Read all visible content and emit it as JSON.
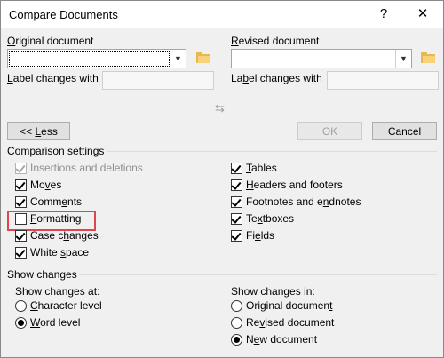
{
  "titlebar": {
    "title": "Compare Documents",
    "help": "?",
    "close": "✕"
  },
  "original": {
    "label_first": "O",
    "label_rest": "riginal document",
    "label_changes_a": "L",
    "label_changes_b": "abel changes with"
  },
  "revised": {
    "label_first": "R",
    "label_rest": "evised document",
    "label_changes_a": "La",
    "label_changes_u": "b",
    "label_changes_b": "el changes with"
  },
  "buttons": {
    "less_a": "<< ",
    "less_u": "L",
    "less_b": "ess",
    "ok": "OK",
    "cancel": "Cancel"
  },
  "comparison_settings": {
    "heading": "Comparison settings",
    "insertions": "Insertions and deletions",
    "moves_a": "Mo",
    "moves_u": "v",
    "moves_b": "es",
    "comments_a": "Comm",
    "comments_u": "e",
    "comments_b": "nts",
    "formatting_u": "F",
    "formatting_b": "ormatting",
    "case_a": "Case c",
    "case_u": "h",
    "case_b": "anges",
    "white_a": "White ",
    "white_u": "s",
    "white_b": "pace",
    "tables_u": "T",
    "tables_b": "ables",
    "headers_u": "H",
    "headers_b": "eaders and footers",
    "footnotes_a": "Footnotes and e",
    "footnotes_u": "n",
    "footnotes_b": "dnotes",
    "textboxes_a": "Te",
    "textboxes_u": "x",
    "textboxes_b": "tboxes",
    "fields_a": "Fi",
    "fields_u": "e",
    "fields_b": "lds"
  },
  "show_changes": {
    "heading": "Show changes",
    "at_label": "Show changes at:",
    "char_u": "C",
    "char_b": "haracter level",
    "word_u": "W",
    "word_b": "ord level",
    "in_label": "Show changes in:",
    "orig_a": "Original documen",
    "orig_u": "t",
    "rev_a": "Re",
    "rev_u": "v",
    "rev_b": "ised document",
    "new_a": "N",
    "new_u": "e",
    "new_b": "w document"
  }
}
